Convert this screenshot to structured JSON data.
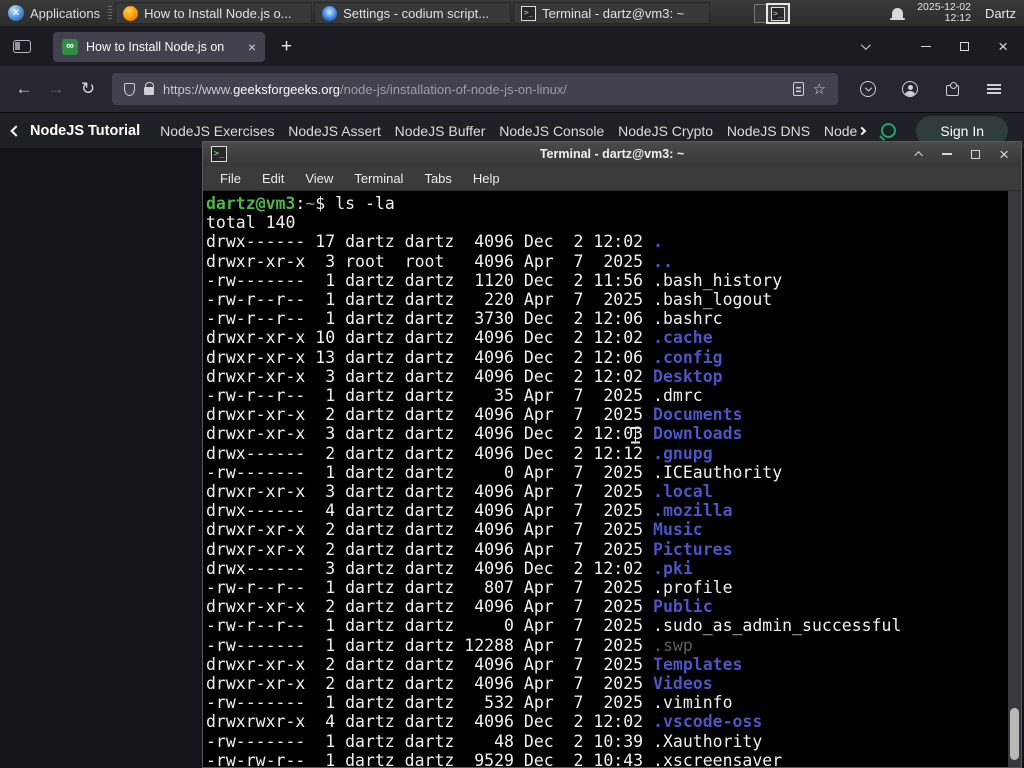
{
  "panel": {
    "applications": {
      "label": "Applications"
    },
    "tasks": [
      {
        "icon": "firefox-icon",
        "label": "How to Install Node.js o..."
      },
      {
        "icon": "codium-icon",
        "label": "Settings - codium script..."
      },
      {
        "icon": "terminal-icon",
        "label": "Terminal - dartz@vm3: ~"
      }
    ],
    "clock": {
      "date": "2025-12-02",
      "time": "12:12"
    },
    "user": "Dartz"
  },
  "browser": {
    "tab": {
      "title": "How to Install Node.js on"
    },
    "url": {
      "protocol": "https://www.",
      "domain": "geeksforgeeks.org",
      "path": "/node-js/installation-of-node-js-on-linux/"
    },
    "site_nav": {
      "back_label": "NodeJS Tutorial",
      "links": [
        "NodeJS Exercises",
        "NodeJS Assert",
        "NodeJS Buffer",
        "NodeJS Console",
        "NodeJS Crypto",
        "NodeJS DNS",
        "Node"
      ],
      "sign_in": "Sign In"
    }
  },
  "terminal": {
    "title": "Terminal - dartz@vm3: ~",
    "menu": [
      "File",
      "Edit",
      "View",
      "Terminal",
      "Tabs",
      "Help"
    ],
    "prompt": {
      "user_host": "dartz@vm3",
      "separator": ":",
      "cwd": "~",
      "dollar": "$ ",
      "command": "ls -la"
    },
    "total_line": "total 140",
    "listing": [
      {
        "meta": "drwx------ 17 dartz dartz  4096 Dec  2 12:02 ",
        "name": ".",
        "kind": "dir"
      },
      {
        "meta": "drwxr-xr-x  3 root  root   4096 Apr  7  2025 ",
        "name": "..",
        "kind": "dir"
      },
      {
        "meta": "-rw-------  1 dartz dartz  1120 Dec  2 11:56 ",
        "name": ".bash_history",
        "kind": "file"
      },
      {
        "meta": "-rw-r--r--  1 dartz dartz   220 Apr  7  2025 ",
        "name": ".bash_logout",
        "kind": "file"
      },
      {
        "meta": "-rw-r--r--  1 dartz dartz  3730 Dec  2 12:06 ",
        "name": ".bashrc",
        "kind": "file"
      },
      {
        "meta": "drwxr-xr-x 10 dartz dartz  4096 Dec  2 12:02 ",
        "name": ".cache",
        "kind": "dir"
      },
      {
        "meta": "drwxr-xr-x 13 dartz dartz  4096 Dec  2 12:06 ",
        "name": ".config",
        "kind": "dir"
      },
      {
        "meta": "drwxr-xr-x  3 dartz dartz  4096 Dec  2 12:02 ",
        "name": "Desktop",
        "kind": "dir"
      },
      {
        "meta": "-rw-r--r--  1 dartz dartz    35 Apr  7  2025 ",
        "name": ".dmrc",
        "kind": "file"
      },
      {
        "meta": "drwxr-xr-x  2 dartz dartz  4096 Apr  7  2025 ",
        "name": "Documents",
        "kind": "dir"
      },
      {
        "meta": "drwxr-xr-x  3 dartz dartz  4096 Dec  2 12:03 ",
        "name": "Downloads",
        "kind": "dir"
      },
      {
        "meta": "drwx------  2 dartz dartz  4096 Dec  2 12:12 ",
        "name": ".gnupg",
        "kind": "dir"
      },
      {
        "meta": "-rw-------  1 dartz dartz     0 Apr  7  2025 ",
        "name": ".ICEauthority",
        "kind": "file"
      },
      {
        "meta": "drwxr-xr-x  3 dartz dartz  4096 Apr  7  2025 ",
        "name": ".local",
        "kind": "dir"
      },
      {
        "meta": "drwx------  4 dartz dartz  4096 Apr  7  2025 ",
        "name": ".mozilla",
        "kind": "dir"
      },
      {
        "meta": "drwxr-xr-x  2 dartz dartz  4096 Apr  7  2025 ",
        "name": "Music",
        "kind": "dir"
      },
      {
        "meta": "drwxr-xr-x  2 dartz dartz  4096 Apr  7  2025 ",
        "name": "Pictures",
        "kind": "dir"
      },
      {
        "meta": "drwx------  3 dartz dartz  4096 Dec  2 12:02 ",
        "name": ".pki",
        "kind": "dir"
      },
      {
        "meta": "-rw-r--r--  1 dartz dartz   807 Apr  7  2025 ",
        "name": ".profile",
        "kind": "file"
      },
      {
        "meta": "drwxr-xr-x  2 dartz dartz  4096 Apr  7  2025 ",
        "name": "Public",
        "kind": "dir"
      },
      {
        "meta": "-rw-r--r--  1 dartz dartz     0 Apr  7  2025 ",
        "name": ".sudo_as_admin_successful",
        "kind": "file"
      },
      {
        "meta": "-rw-------  1 dartz dartz 12288 Apr  7  2025 ",
        "name": ".swp",
        "kind": "dim"
      },
      {
        "meta": "drwxr-xr-x  2 dartz dartz  4096 Apr  7  2025 ",
        "name": "Templates",
        "kind": "dir"
      },
      {
        "meta": "drwxr-xr-x  2 dartz dartz  4096 Apr  7  2025 ",
        "name": "Videos",
        "kind": "dir"
      },
      {
        "meta": "-rw-------  1 dartz dartz   532 Apr  7  2025 ",
        "name": ".viminfo",
        "kind": "file"
      },
      {
        "meta": "drwxrwxr-x  4 dartz dartz  4096 Dec  2 12:02 ",
        "name": ".vscode-oss",
        "kind": "dir"
      },
      {
        "meta": "-rw-------  1 dartz dartz    48 Dec  2 10:39 ",
        "name": ".Xauthority",
        "kind": "file"
      },
      {
        "meta": "-rw-rw-r--  1 dartz dartz  9529 Dec  2 10:43 ",
        "name": ".xscreensaver",
        "kind": "file"
      }
    ]
  },
  "icons": {
    "applications_logo": "×",
    "terminal_glyph": ">_",
    "favicon_glyph": "∞",
    "new_tab": "+",
    "close_tab": "×",
    "close_window": "×",
    "back": "←",
    "forward": "→",
    "reload": "↻",
    "star": "☆"
  },
  "colors": {
    "gfg_green": "#2f8d46",
    "search_green": "#26a269",
    "dir_blue": "#4c55c5",
    "prompt_green": "#4cb944",
    "cwd_blue": "#7d9fc0",
    "active_tab_bg": "#42414d"
  }
}
